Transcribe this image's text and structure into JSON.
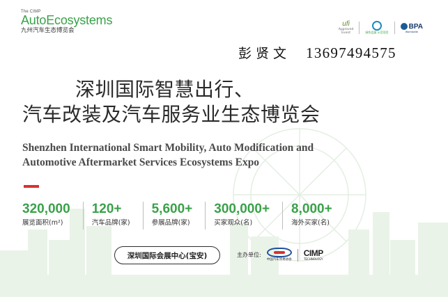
{
  "logo": {
    "small": "The CIMP",
    "main": "AutoEcosystems",
    "cn": "九州汽车生态博览会"
  },
  "partners": {
    "ufi": {
      "mark": "ufi",
      "sub1": "Approved",
      "sub2": "Event"
    },
    "badge": {
      "sub": "绿色会展 示范项目"
    },
    "bpa": {
      "name": "BPA",
      "sub": "Worldwide"
    }
  },
  "contact": {
    "name": "彭贤文",
    "phone": "13697494575"
  },
  "title": {
    "cn_line1": "深圳国际智慧出行、",
    "cn_line2": "汽车改装及汽车服务业生态博览会",
    "en_line1": "Shenzhen International Smart Mobility, Auto Modification and",
    "en_line2": "Automotive Aftermarket Services Ecosystems Expo"
  },
  "stats": [
    {
      "value": "320,000",
      "label": "展览面积(m²)"
    },
    {
      "value": "120+",
      "label": "汽车品牌(家)"
    },
    {
      "value": "5,600+",
      "label": "参展品牌(家)"
    },
    {
      "value": "300,000+",
      "label": "买家观众(名)"
    },
    {
      "value": "8,000+",
      "label": "海外买家(名)"
    }
  ],
  "venue": "深圳国际会展中心(宝安)",
  "organizers": {
    "label": "主办单位:",
    "caam_sub": "中国汽车贸易协会",
    "cimp_name": "CIMP",
    "cimp_sub": "TECHNOLOGY"
  },
  "colors": {
    "brand_green": "#3aa14a",
    "accent_red": "#d8322f",
    "text_dark": "#2a2a2a"
  }
}
